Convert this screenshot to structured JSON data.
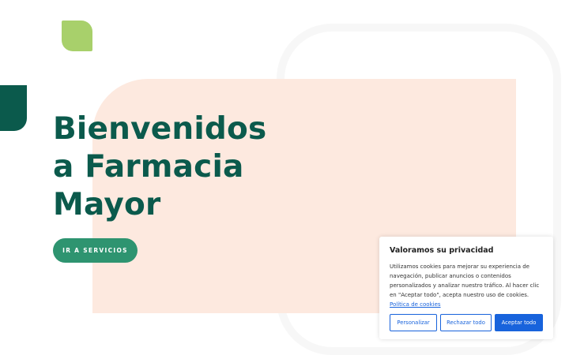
{
  "hero": {
    "title_lines": [
      "Bienvenidos",
      "a Farmacia",
      "Mayor"
    ],
    "cta_label": "IR A SERVICIOS"
  },
  "cookie_banner": {
    "title": "Valoramos su privacidad",
    "text": "Utilizamos cookies para mejorar su experiencia de navegación, publicar anuncios o contenidos personalizados y analizar nuestro tráfico. Al hacer clic en \"Aceptar todo\", acepta nuestro uso de cookies.",
    "policy_link": "Política de cookies",
    "buttons": {
      "customize": "Personalizar",
      "reject": "Rechazar todo",
      "accept": "Aceptar todo"
    }
  },
  "colors": {
    "brand_green": "#0b5a4c",
    "cta_green": "#2e9470",
    "leaf_green": "#a8d06b",
    "peach": "#fde9df",
    "cookie_blue": "#1863dc"
  }
}
